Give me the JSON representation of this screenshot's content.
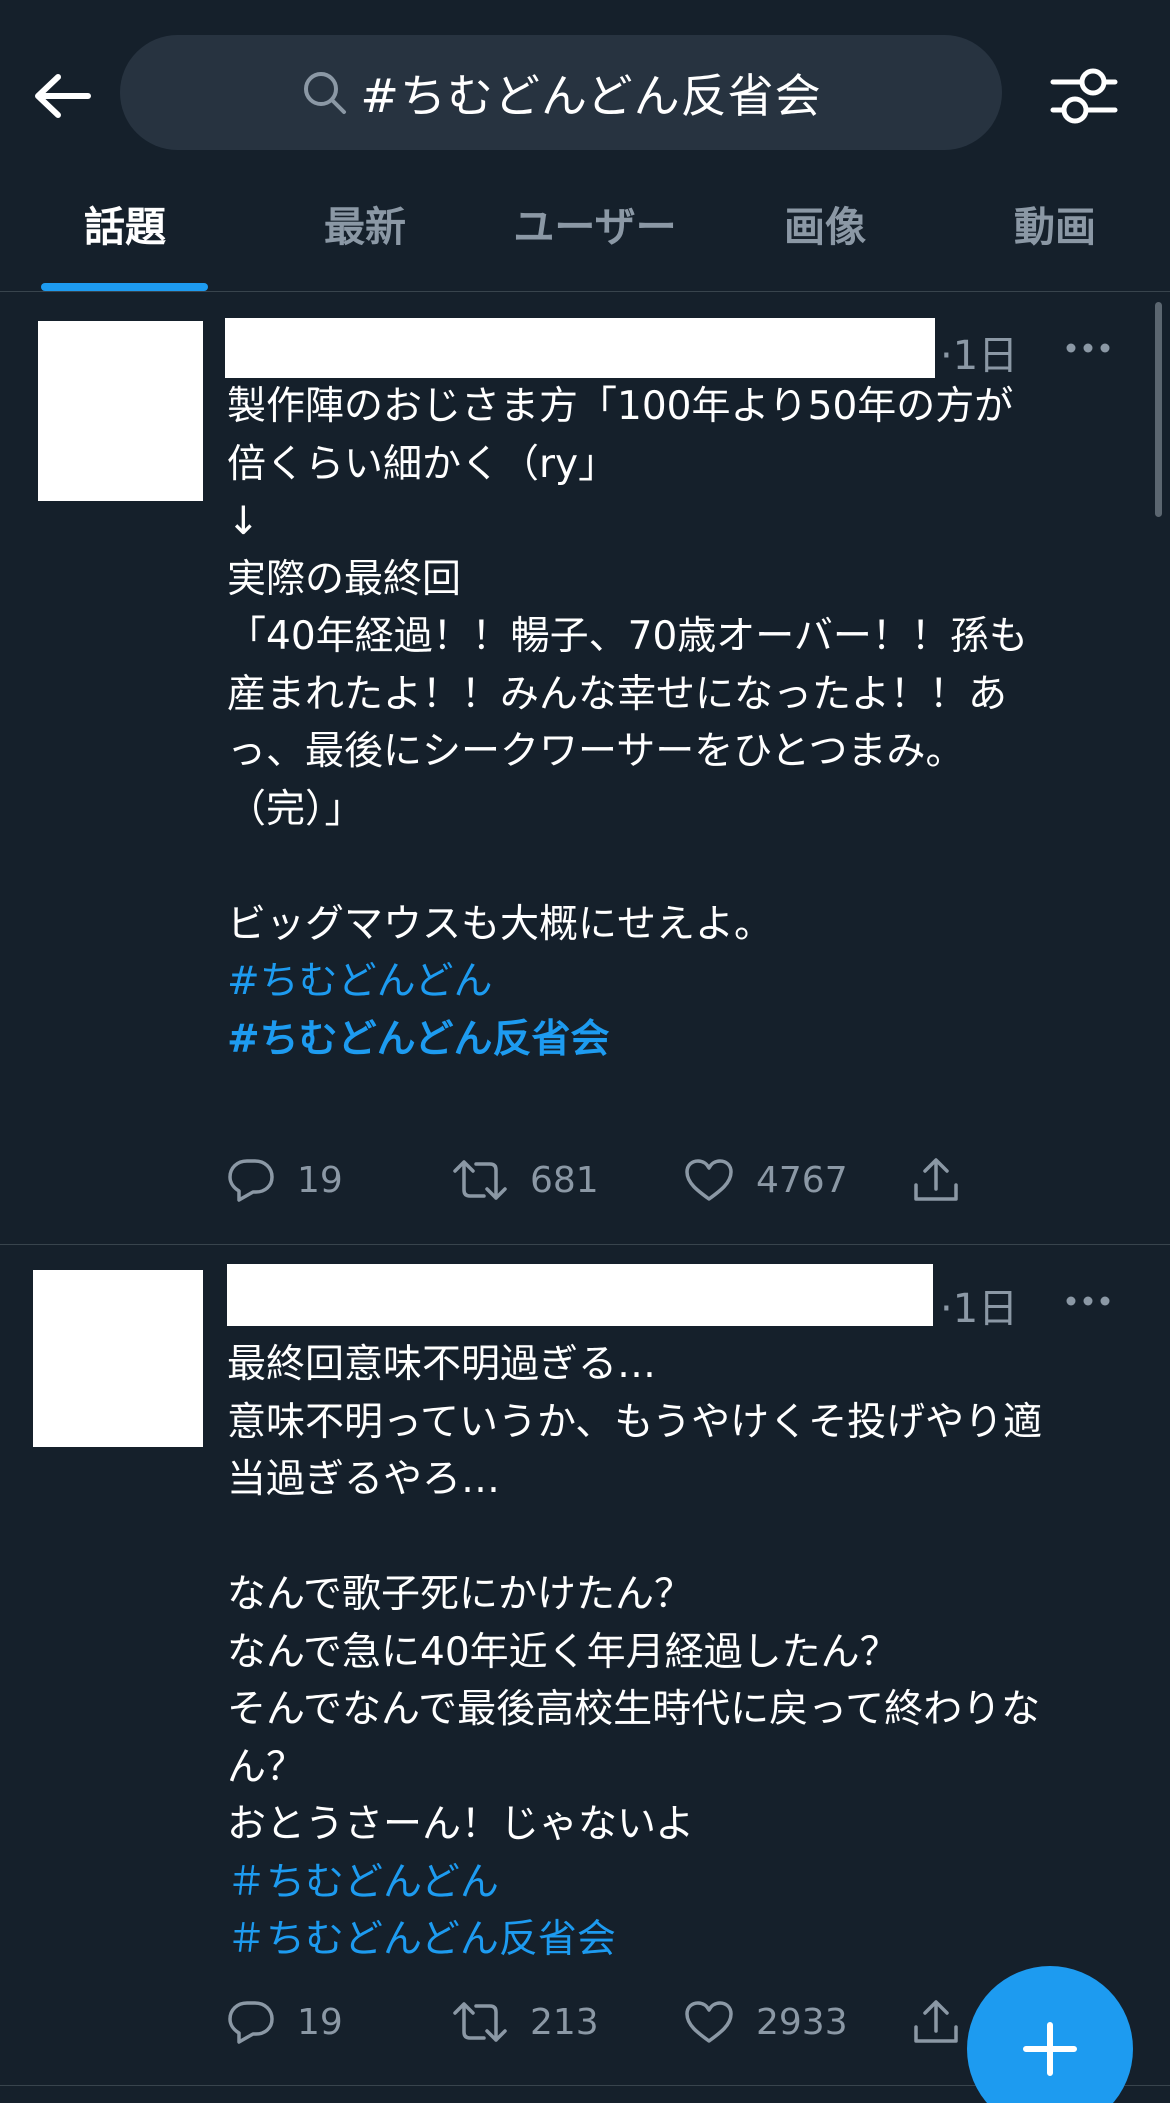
{
  "search": {
    "query": "#ちむどんどん反省会"
  },
  "tabs": [
    {
      "label": "話題"
    },
    {
      "label": "最新"
    },
    {
      "label": "ユーザー"
    },
    {
      "label": "画像"
    },
    {
      "label": "動画"
    }
  ],
  "tweets": [
    {
      "time": "·1日",
      "text": "製作陣のおじさま方「100年より50年の方が\n倍くらい細かく（ry」\n↓\n実際の最終回\n「40年経過！！暢子、70歳オーバー！！孫も\n産まれたよ！！みんな幸せになったよ！！あ\nっ、最後にシークワーサーをひとつまみ。\n（完）」\n\nビッグマウスも大概にせえよ。\n",
      "hashtags": [
        "#ちむどんどん",
        "#ちむどんどん反省会"
      ],
      "replies": "19",
      "retweets": "681",
      "likes": "4767"
    },
    {
      "time": "·1日",
      "text": "最終回意味不明過ぎる…\n意味不明っていうか、もうやけくそ投げやり適\n当過ぎるやろ…\n\nなんで歌子死にかけたん？\nなんで急に40年近く年月経過したん？\nそんでなんで最後高校生時代に戻って終わりな\nん？\nおとうさーん！じゃないよ",
      "hashtags": [
        "＃ちむどんどん",
        "＃ちむどんどん反省会"
      ],
      "replies": "19",
      "retweets": "213",
      "likes": "2933"
    }
  ],
  "colors": {
    "background": "#15202b",
    "search_bg": "#273340",
    "accent": "#1d9bf0",
    "muted": "#8b98a5",
    "divider": "#38444d"
  },
  "icons": [
    "back-arrow-icon",
    "search-icon",
    "filter-icon",
    "more-icon",
    "reply-icon",
    "retweet-icon",
    "like-icon",
    "share-icon",
    "compose-plus-icon"
  ]
}
